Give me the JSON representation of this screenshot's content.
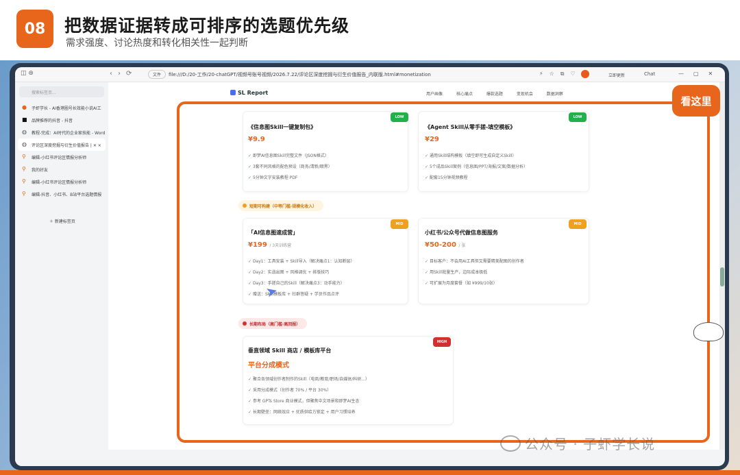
{
  "slide": {
    "number": "08",
    "title": "把数据证据转成可排序的选题优先级",
    "subtitle": "需求强度、讨论热度和转化相关性一起判断"
  },
  "browser": {
    "url_label": "文件",
    "url": "file:///D:/20-工作/20-chatGPT/视频号账号视频/2026.7.22/评论区深度挖掘与衍生价值报告_内联版.html#monetization",
    "right_text_1": "立即更新",
    "right_text_2": "Chat",
    "search_placeholder": "搜索标签页...",
    "tabs": [
      "子虾学长 - AI香港圈号长效能小说AI工",
      "品牌推荐的抖音 - 抖音",
      "教程-完成：AI时代的企业家技能 - Word",
      "评论区深度挖掘与衍生价值报告 | ✕ ×",
      "编辑-小红书评论区情报分析师",
      "我的好友",
      "编辑-小红书评论区情报分析师",
      "编辑-抖音、小红书、B站平台选题情报"
    ],
    "new_tab": "新建标签页"
  },
  "report": {
    "brand": "SL Report",
    "nav": [
      "用户画像",
      "核心痛点",
      "爆款选题",
      "变现机会",
      "数据洞察"
    ]
  },
  "cards": [
    {
      "tag": "LOW",
      "title": "《信息图Skill一键复制包》",
      "price": "¥9.9",
      "price_note": "",
      "bullets": [
        "即梦AI信息图Skill完整文件（JSON格式）",
        "3套不同风格的配色预设（商务/清新/暗黑）",
        "5分钟文字安装教程 PDF"
      ]
    },
    {
      "tag": "LOW",
      "title": "《Agent Skill从零手搓-填空模板》",
      "price": "¥29",
      "price_note": "",
      "bullets": [
        "通用Skill结构模板（填空即可生成自定义Skill）",
        "5个成品Skill案例（信息图/PPT/海报/文案/数据分析）",
        "配套15分钟视频教程"
      ]
    },
    {
      "tag": "MID",
      "title": "「AI信息图速成营」",
      "price": "¥199",
      "price_note": "/ 3天训练营",
      "bullets": [
        "Day1：工具安装 + Skill导入（解决痛点1：认知断层）",
        "Day2：实战出图 + 风格调优 + 排版技巧",
        "Day3：手搓自己的Skill（解决痛点3：动手能力）",
        "赠送：Skill模板库 + 社群答疑 + 学员作品点评"
      ]
    },
    {
      "tag": "MID",
      "title": "小红书/公众号代做信息图服务",
      "price": "¥50-200",
      "price_note": "/ 张",
      "bullets": [
        "目标客户：不会用AI工具但又需要精美配图的创作者",
        "用Skill批量生产，边际成本极低",
        "可扩展为月度套餐（如 ¥999/10张）"
      ]
    },
    {
      "tag": "HIGH",
      "title": "垂直领域 Skill 商店 / 模板库平台",
      "price": "平台分成模式",
      "price_note": "",
      "bullets": [
        "聚合各领域创作者制作的Skill（电商/教育/职场/自媒体/科研...）",
        "采用分成模式（创作者 70% / 平台 30%）",
        "参考 GPTs Store 商业模式，但聚焦中文场景和即梦AI生态",
        "长期壁垒：网络效应 + 优质供给方锁定 + 用户习惯培养"
      ]
    }
  ],
  "sections": {
    "mid": "短期可构建（中等门槛·规模化收入）",
    "high": "长期布局（高门槛·高回报）"
  },
  "overlay": {
    "callout": "看这里"
  },
  "watermark": "公众号 · 子虾学长说",
  "colors": {
    "accent": "#e8661c",
    "low": "#22b04a",
    "mid": "#f0a020",
    "high": "#d03030"
  }
}
